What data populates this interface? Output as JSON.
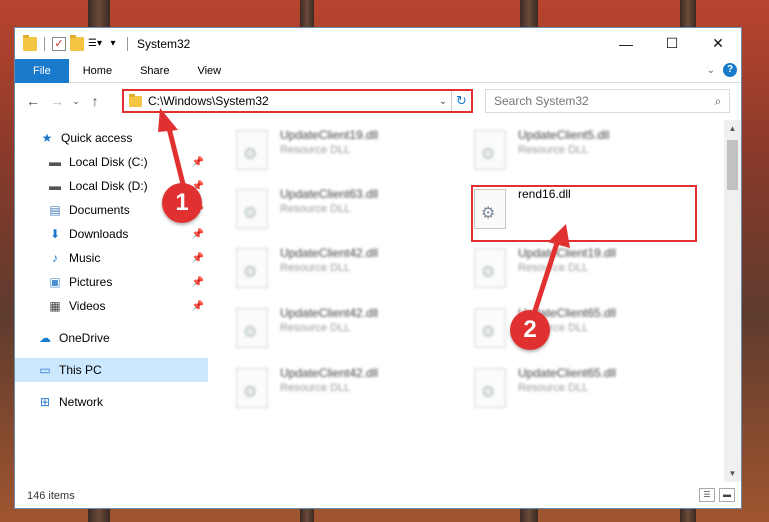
{
  "window": {
    "title": "System32",
    "controls": {
      "minimize": "—",
      "maximize": "☐",
      "close": "✕"
    }
  },
  "ribbon": {
    "tabs": [
      "File",
      "Home",
      "Share",
      "View"
    ]
  },
  "address": {
    "path": "C:\\Windows\\System32",
    "search_placeholder": "Search System32"
  },
  "nav_pane": {
    "items": [
      {
        "label": "Quick access",
        "icon": "star-icon"
      },
      {
        "label": "Local Disk (C:)",
        "icon": "drive-icon",
        "pinned": true
      },
      {
        "label": "Local Disk (D:)",
        "icon": "drive-icon",
        "pinned": true
      },
      {
        "label": "Documents",
        "icon": "documents-icon",
        "pinned": true
      },
      {
        "label": "Downloads",
        "icon": "download-icon",
        "pinned": true
      },
      {
        "label": "Music",
        "icon": "music-icon",
        "pinned": true
      },
      {
        "label": "Pictures",
        "icon": "pictures-icon",
        "pinned": true
      },
      {
        "label": "Videos",
        "icon": "videos-icon",
        "pinned": true
      },
      {
        "label": "OneDrive",
        "icon": "cloud-icon"
      },
      {
        "label": "This PC",
        "icon": "computer-icon",
        "selected": true
      },
      {
        "label": "Network",
        "icon": "network-icon"
      }
    ]
  },
  "files": [
    {
      "name": "UpdateClient19.dll",
      "type": "Resource DLL"
    },
    {
      "name": "UpdateClient5.dll",
      "type": "Resource DLL"
    },
    {
      "name": "UpdateClient63.dll",
      "type": "Resource DLL"
    },
    {
      "name": "rend16.dll",
      "type": ""
    },
    {
      "name": "UpdateClient42.dll",
      "type": "Resource DLL"
    },
    {
      "name": "UpdateClient19.dll",
      "type": "Resource DLL"
    },
    {
      "name": "UpdateClient42.dll",
      "type": "Resource DLL"
    },
    {
      "name": "UpdateClient65.dll",
      "type": "Resource DLL"
    },
    {
      "name": "UpdateClient42.dll",
      "type": "Resource DLL"
    },
    {
      "name": "UpdateClient65.dll",
      "type": "Resource DLL"
    }
  ],
  "status": {
    "item_count": "146 items"
  },
  "callouts": [
    "1",
    "2"
  ],
  "colors": {
    "accent": "#1979ca",
    "highlight": "#e03030",
    "selected": "#cce8ff"
  }
}
